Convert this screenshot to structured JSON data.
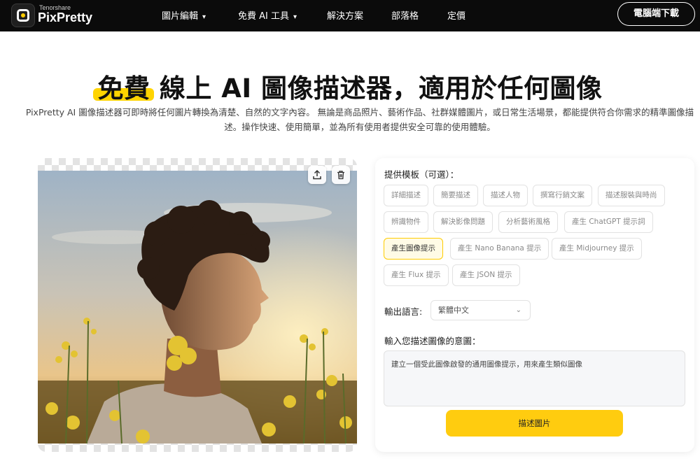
{
  "header": {
    "brand_small": "Tenorshare",
    "brand_name": "PixPretty",
    "menu": [
      {
        "label": "圖片編輯",
        "has_dropdown": true
      },
      {
        "label": "免費 AI 工具",
        "has_dropdown": true
      },
      {
        "label": "解決方案",
        "has_dropdown": false
      },
      {
        "label": "部落格",
        "has_dropdown": false
      },
      {
        "label": "定價",
        "has_dropdown": false
      }
    ],
    "download_label": "電腦端下載",
    "dropdown_icon": "▾"
  },
  "hero": {
    "title_highlight": "免費",
    "title_rest": "線上 AI 圖像描述器，適用於任何圖像",
    "description": "PixPretty AI 圖像描述器可即時將任何圖片轉換為清楚、自然的文字內容。 無論是商品照片、藝術作品、社群媒體圖片，或日常生活場景，都能提供符合你需求的精準圖像描述。操作快速、使用簡單，並為所有使用者提供安全可靠的使用體驗。"
  },
  "image_panel": {
    "icons": [
      "upload-icon",
      "trash-icon"
    ]
  },
  "form": {
    "template_label": "提供模板（可選）：",
    "templates": [
      {
        "label": "詳細描述",
        "active": false
      },
      {
        "label": "簡要描述",
        "active": false
      },
      {
        "label": "描述人物",
        "active": false
      },
      {
        "label": "撰寫行銷文案",
        "active": false
      },
      {
        "label": "描述服裝與時尚",
        "active": false
      },
      {
        "label": "辨識物件",
        "active": false
      },
      {
        "label": "解決影像問題",
        "active": false
      },
      {
        "label": "分析藝術風格",
        "active": false
      },
      {
        "label": "產生 ChatGPT 提示詞",
        "active": false
      },
      {
        "label": "產生圖像提示",
        "active": true
      },
      {
        "label": "產生 Nano Banana 提示",
        "active": false
      },
      {
        "label": "產生 Midjourney 提示",
        "active": false
      },
      {
        "label": "產生 Flux 提示",
        "active": false
      },
      {
        "label": "產生 JSON 提示",
        "active": false
      }
    ],
    "language_label": "輸出語言:",
    "language_value": "繁體中文",
    "intent_label": "輸入您描述圖像的意圖：",
    "intent_value": "建立一個受此圖像啟發的通用圖像提示，用來產生類似圖像",
    "submit_label": "描述圖片"
  },
  "colors": {
    "accent": "#ffcc0f",
    "nav_bg": "#0b0b0b"
  }
}
